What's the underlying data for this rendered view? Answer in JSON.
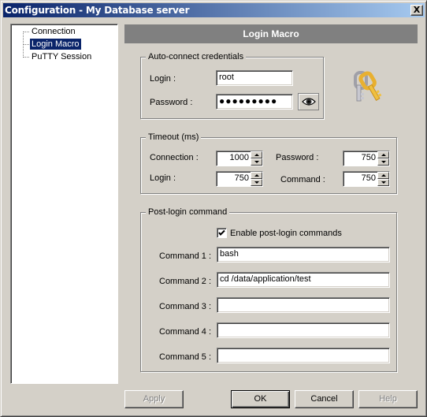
{
  "window": {
    "title": "Configuration - My Database server",
    "close_label": "X"
  },
  "tree": {
    "items": [
      {
        "label": "Connection",
        "selected": false
      },
      {
        "label": "Login Macro",
        "selected": true
      },
      {
        "label": "PuTTY Session",
        "selected": false
      }
    ]
  },
  "panel": {
    "header": "Login Macro",
    "credentials": {
      "group_label": "Auto-connect credentials",
      "login_label": "Login :",
      "login_value": "root",
      "password_label": "Password :",
      "password_value": "●●●●●●●●●",
      "show_password_icon": "eye-icon"
    },
    "keys_icon": "keys-icon",
    "timeout": {
      "group_label": "Timeout (ms)",
      "connection_label": "Connection :",
      "connection_value": "1000",
      "login_label": "Login :",
      "login_value": "750",
      "password_label": "Password :",
      "password_value": "750",
      "command_label": "Command :",
      "command_value": "750"
    },
    "post_login": {
      "group_label": "Post-login command",
      "enable_label": "Enable post-login commands",
      "enable_checked": true,
      "commands": [
        {
          "label": "Command 1 :",
          "value": "bash"
        },
        {
          "label": "Command 2 :",
          "value": "cd /data/application/test"
        },
        {
          "label": "Command 3 :",
          "value": ""
        },
        {
          "label": "Command 4 :",
          "value": ""
        },
        {
          "label": "Command 5 :",
          "value": ""
        }
      ]
    }
  },
  "buttons": {
    "apply": "Apply",
    "ok": "OK",
    "cancel": "Cancel",
    "help": "Help"
  }
}
